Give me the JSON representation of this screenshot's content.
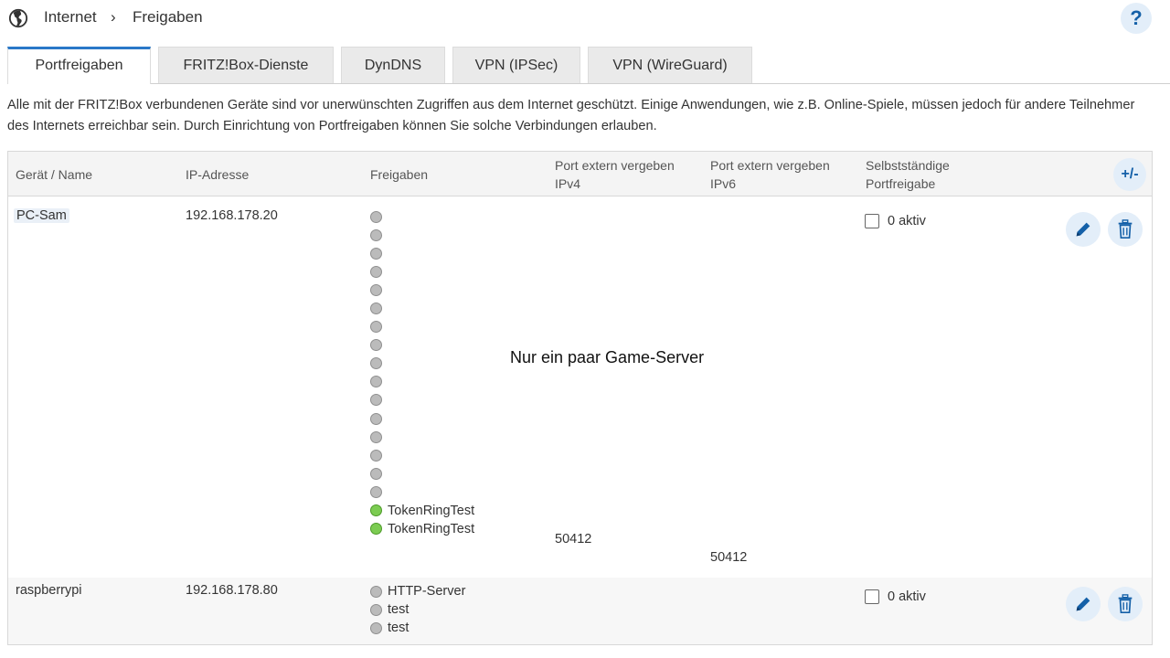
{
  "header": {
    "breadcrumb": [
      "Internet",
      "Freigaben"
    ],
    "separator": "›",
    "help_label": "?"
  },
  "tabs": [
    {
      "label": "Portfreigaben",
      "active": true
    },
    {
      "label": "FRITZ!Box-Dienste",
      "active": false
    },
    {
      "label": "DynDNS",
      "active": false
    },
    {
      "label": "VPN (IPSec)",
      "active": false
    },
    {
      "label": "VPN (WireGuard)",
      "active": false
    }
  ],
  "intro": "Alle mit der FRITZ!Box verbundenen Geräte sind vor unerwünschten Zugriffen aus dem Internet geschützt. Einige Anwendungen, wie z.B. Online-Spiele, müssen jedoch für andere Teilnehmer des Internets erreichbar sein. Durch Einrichtung von Portfreigaben können Sie solche Verbindungen erlauben.",
  "table": {
    "headers": {
      "device": "Gerät / Name",
      "ip": "IP-Adresse",
      "shares": "Freigaben",
      "port_ipv4_l1": "Port extern vergeben",
      "port_ipv4_l2": "IPv4",
      "port_ipv6_l1": "Port extern vergeben",
      "port_ipv6_l2": "IPv6",
      "self_l1": "Selbstständige",
      "self_l2": "Portfreigabe",
      "add_icon": "+/-"
    },
    "rows": [
      {
        "name": "PC-Sam",
        "ip": "192.168.178.20",
        "rules": [
          {
            "label": "",
            "status": "inactive"
          },
          {
            "label": "",
            "status": "inactive"
          },
          {
            "label": "",
            "status": "inactive"
          },
          {
            "label": "",
            "status": "inactive"
          },
          {
            "label": "",
            "status": "inactive"
          },
          {
            "label": "",
            "status": "inactive"
          },
          {
            "label": "",
            "status": "inactive"
          },
          {
            "label": "",
            "status": "inactive"
          },
          {
            "label": "",
            "status": "inactive"
          },
          {
            "label": "",
            "status": "inactive"
          },
          {
            "label": "",
            "status": "inactive"
          },
          {
            "label": "",
            "status": "inactive"
          },
          {
            "label": "",
            "status": "inactive"
          },
          {
            "label": "",
            "status": "inactive"
          },
          {
            "label": "",
            "status": "inactive"
          },
          {
            "label": "",
            "status": "inactive"
          },
          {
            "label": "TokenRingTest",
            "status": "active"
          },
          {
            "label": "TokenRingTest",
            "status": "active"
          }
        ],
        "port_ipv4": "50412",
        "port_ipv6": "50412",
        "self_checked": false,
        "self_label": "0 aktiv"
      },
      {
        "name": "raspberrypi",
        "ip": "192.168.178.80",
        "rules": [
          {
            "label": "HTTP-Server",
            "status": "inactive"
          },
          {
            "label": "test",
            "status": "inactive"
          },
          {
            "label": "test",
            "status": "inactive"
          }
        ],
        "port_ipv4": "",
        "port_ipv6": "",
        "self_checked": false,
        "self_label": "0 aktiv"
      }
    ]
  },
  "overlay_text": "Nur ein paar Game-Server",
  "colors": {
    "accent": "#2a78c8",
    "button_bg": "#e3eef9",
    "icon_blue": "#1460a8",
    "active_dot": "#7ccc52",
    "inactive_dot": "#bbbbbb"
  },
  "icons": {
    "globe": "globe-icon",
    "edit": "pencil-icon",
    "delete": "trash-icon",
    "add": "plus-minus-icon"
  }
}
